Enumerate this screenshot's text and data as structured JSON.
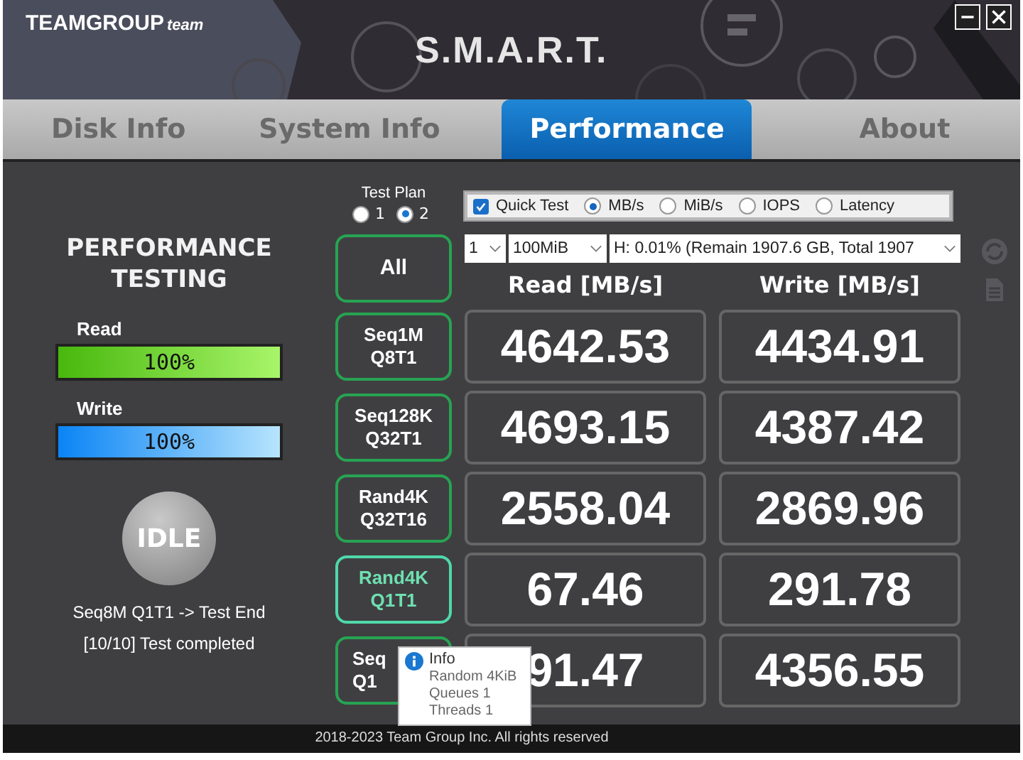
{
  "header": {
    "logo": "TEAMGROUP",
    "logo_suffix": "team",
    "title": "S.M.A.R.T.",
    "window_buttons": [
      {
        "kind": "minimize"
      },
      {
        "kind": "close"
      }
    ]
  },
  "tabs": [
    {
      "label": "Disk Info",
      "selected": false
    },
    {
      "label": "System Info",
      "selected": false
    },
    {
      "label": "Performance",
      "selected": true
    },
    {
      "label": "About",
      "selected": false
    }
  ],
  "left_panel": {
    "heading": "PERFORMANCE TESTING",
    "meters": [
      {
        "label": "Read",
        "reading": "100%",
        "level": 1,
        "kind": "read"
      },
      {
        "label": "Write",
        "reading": "100%",
        "level": 1,
        "kind": "write"
      }
    ],
    "status_button": "IDLE",
    "status_lines": [
      "Seq8M Q1T1 -> Test End",
      "[10/10] Test completed"
    ]
  },
  "test_plan": {
    "label": "Test Plan",
    "options": [
      {
        "label": "1",
        "selected": false
      },
      {
        "label": "2",
        "selected": true
      }
    ]
  },
  "options": {
    "quick_test": {
      "label": "Quick Test",
      "checked": true
    },
    "units": [
      {
        "label": "MB/s",
        "selected": true
      },
      {
        "label": "MiB/s",
        "selected": false
      },
      {
        "label": "IOPS",
        "selected": false
      },
      {
        "label": "Latency",
        "selected": false
      }
    ]
  },
  "all_button": "All",
  "selects": [
    {
      "value": "1"
    },
    {
      "value": "100MiB"
    },
    {
      "value": "H: 0.01% (Remain 1907.6 GB, Total 1907"
    }
  ],
  "columns": [
    "Read [MB/s]",
    "Write [MB/s]"
  ],
  "rows": [
    {
      "test": [
        "Seq1M",
        "Q8T1"
      ],
      "selected": false,
      "read": "4642.53",
      "write": "4434.91"
    },
    {
      "test": [
        "Seq128K",
        "Q32T1"
      ],
      "selected": false,
      "read": "4693.15",
      "write": "4387.42"
    },
    {
      "test": [
        "Rand4K",
        "Q32T16"
      ],
      "selected": false,
      "read": "2558.04",
      "write": "2869.96"
    },
    {
      "test": [
        "Rand4K",
        "Q1T1"
      ],
      "selected": true,
      "read": "67.46",
      "write": "291.78"
    },
    {
      "test": [
        "Seq",
        "Q1"
      ],
      "selected": false,
      "read": "91.47",
      "write": "4356.55"
    }
  ],
  "tooltip": {
    "title": "Info",
    "lines": [
      "Random 4KiB",
      "Queues 1",
      "Threads 1"
    ]
  },
  "footer": "2018-2023 Team Group Inc. All rights reserved"
}
